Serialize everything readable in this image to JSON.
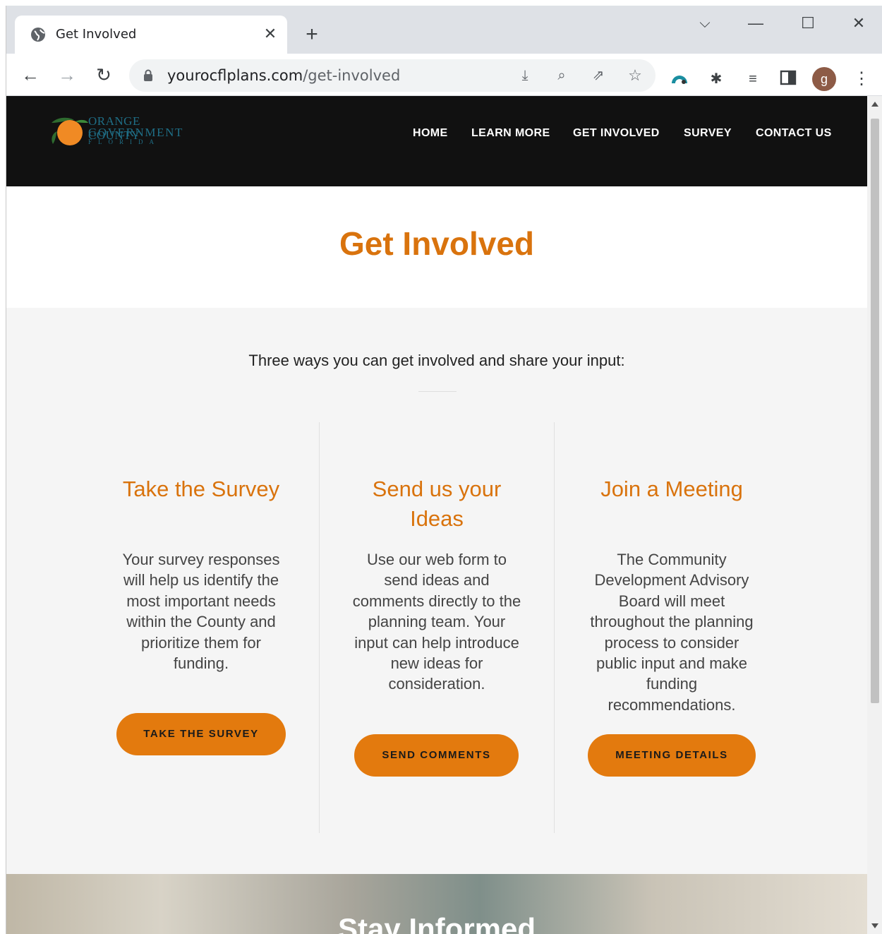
{
  "browser": {
    "tab_title": "Get Involved",
    "tab_close": "✕",
    "new_tab": "+",
    "url_domain": "yourocflplans.com",
    "url_path": "/get-involved",
    "avatar_letter": "g",
    "window_controls": {
      "dropdown": "⌵",
      "minimize": "—",
      "maximize": "☐",
      "close": "✕"
    }
  },
  "site": {
    "logo": {
      "line1": "ORANGE COUNTY",
      "line2": "GOVERNMENT",
      "line3": "FLORIDA"
    },
    "nav": [
      {
        "label": "HOME"
      },
      {
        "label": "LEARN MORE"
      },
      {
        "label": "GET INVOLVED"
      },
      {
        "label": "SURVEY"
      },
      {
        "label": "CONTACT US"
      }
    ]
  },
  "hero": {
    "title": "Get Involved"
  },
  "section": {
    "intro": "Three ways you can get involved and share your input:",
    "columns": [
      {
        "title_lines": [
          "Take the Survey"
        ],
        "text_lines": [
          "Your survey responses",
          "will help us identify the",
          "most important needs",
          "within the County and",
          "prioritize them for",
          "funding."
        ],
        "button": "TAKE THE SURVEY"
      },
      {
        "title_lines": [
          "Send us your",
          "Ideas"
        ],
        "text_lines": [
          "Use our web form to",
          "send ideas and",
          "comments directly to the",
          "planning team. Your",
          "input can help introduce",
          "new ideas for",
          "consideration."
        ],
        "button": "SEND COMMENTS"
      },
      {
        "title_lines": [
          "Join a Meeting"
        ],
        "text_lines": [
          "The Community",
          "Development Advisory",
          "Board will meet",
          "throughout the planning",
          "process to consider",
          "public input and make",
          "funding",
          "recommendations."
        ],
        "button": "MEETING DETAILS"
      }
    ]
  },
  "stay": {
    "title": "Stay Informed"
  },
  "colors": {
    "accent": "#d9730d",
    "button": "#e37a0e",
    "header_bg": "#111111",
    "section_bg": "#f5f5f5"
  }
}
